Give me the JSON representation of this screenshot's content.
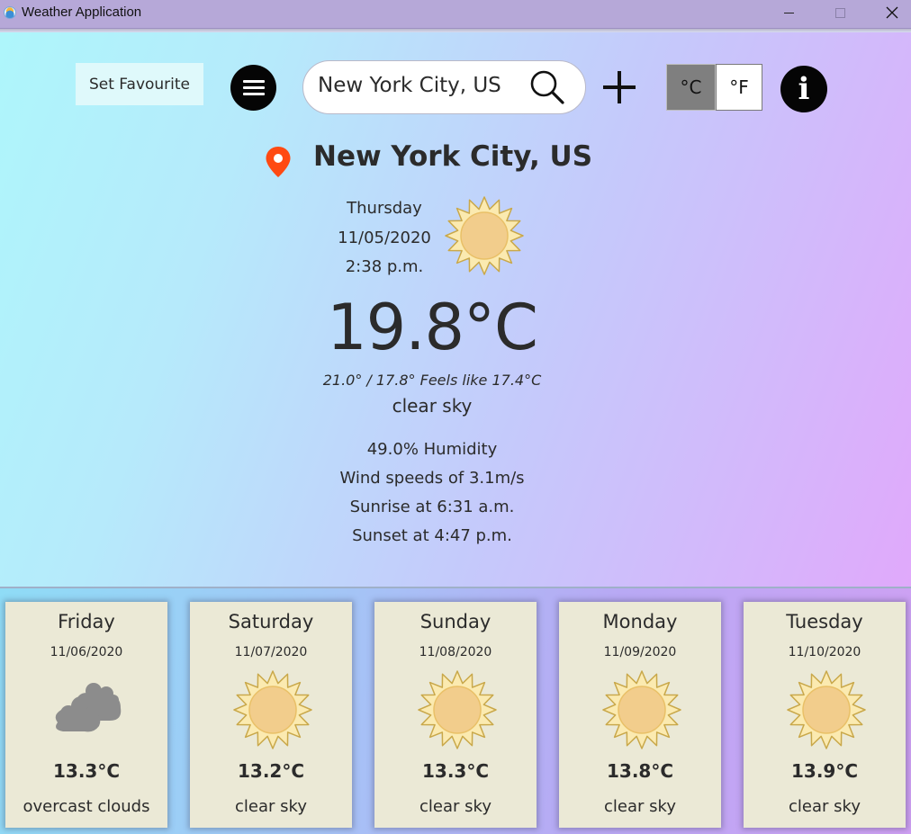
{
  "window": {
    "title": "Weather Application",
    "icon": "app-weather-icon",
    "controls": [
      "minimize",
      "maximize",
      "close"
    ]
  },
  "toolbar": {
    "favourite_label": "Set Favourite",
    "menu_icon": "hamburger-menu-icon",
    "search_value": "New York City, US",
    "search_icon": "search-icon",
    "add_icon": "plus-icon",
    "unit_celsius": "°C",
    "unit_fahrenheit": "°F",
    "selected_unit": "°C",
    "info_label": "i"
  },
  "current": {
    "location": "New York City, US",
    "day": "Thursday",
    "date": "11/05/2020",
    "time": "2:38 p.m.",
    "icon": "sun-icon",
    "temperature": "19.8°C",
    "minmax_feels": "21.0° / 17.8° Feels like 17.4°C",
    "description": "clear sky",
    "humidity": "49.0% Humidity",
    "wind": "Wind speeds of 3.1m/s",
    "sunrise": "Sunrise at 6:31 a.m.",
    "sunset": "Sunset at 4:47 p.m."
  },
  "forecast": [
    {
      "day": "Friday",
      "date": "11/06/2020",
      "icon": "cloud-icon",
      "temp": "13.3°C",
      "desc": "overcast clouds"
    },
    {
      "day": "Saturday",
      "date": "11/07/2020",
      "icon": "sun-icon",
      "temp": "13.2°C",
      "desc": "clear sky"
    },
    {
      "day": "Sunday",
      "date": "11/08/2020",
      "icon": "sun-icon",
      "temp": "13.3°C",
      "desc": "clear sky"
    },
    {
      "day": "Monday",
      "date": "11/09/2020",
      "icon": "sun-icon",
      "temp": "13.8°C",
      "desc": "clear sky"
    },
    {
      "day": "Tuesday",
      "date": "11/10/2020",
      "icon": "sun-icon",
      "temp": "13.9°C",
      "desc": "clear sky"
    }
  ],
  "colors": {
    "sun_fill": "#f2cd8c",
    "sun_rays": "#fbeab0",
    "sun_stroke": "#c9a84a",
    "cloud": "#8c8c8c",
    "pin": "#ff4a12",
    "card_bg": "#ebe9d6"
  }
}
